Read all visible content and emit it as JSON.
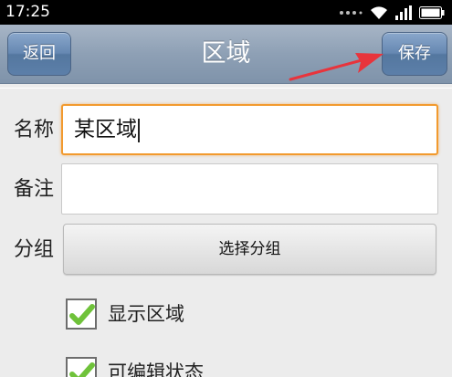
{
  "status_bar": {
    "time": "17:25",
    "icons": [
      "signal-icon",
      "wifi-icon",
      "signal-bars-icon",
      "battery-icon"
    ]
  },
  "title_bar": {
    "back_label": "返回",
    "title": "区域",
    "save_label": "保存"
  },
  "form": {
    "name_label": "名称",
    "name_value": "某区域",
    "note_label": "备注",
    "note_value": "",
    "group_label": "分组",
    "group_button": "选择分组",
    "show_area": {
      "label": "显示区域",
      "checked": true
    },
    "editable": {
      "label": "可编辑状态",
      "checked": true
    }
  },
  "colors": {
    "title_bar": "#8ea0b5",
    "nav_button": "#6688b2",
    "focus_border": "#f29a2e",
    "checkmark": "#6fc23a",
    "annotation_arrow": "#e8343c"
  }
}
